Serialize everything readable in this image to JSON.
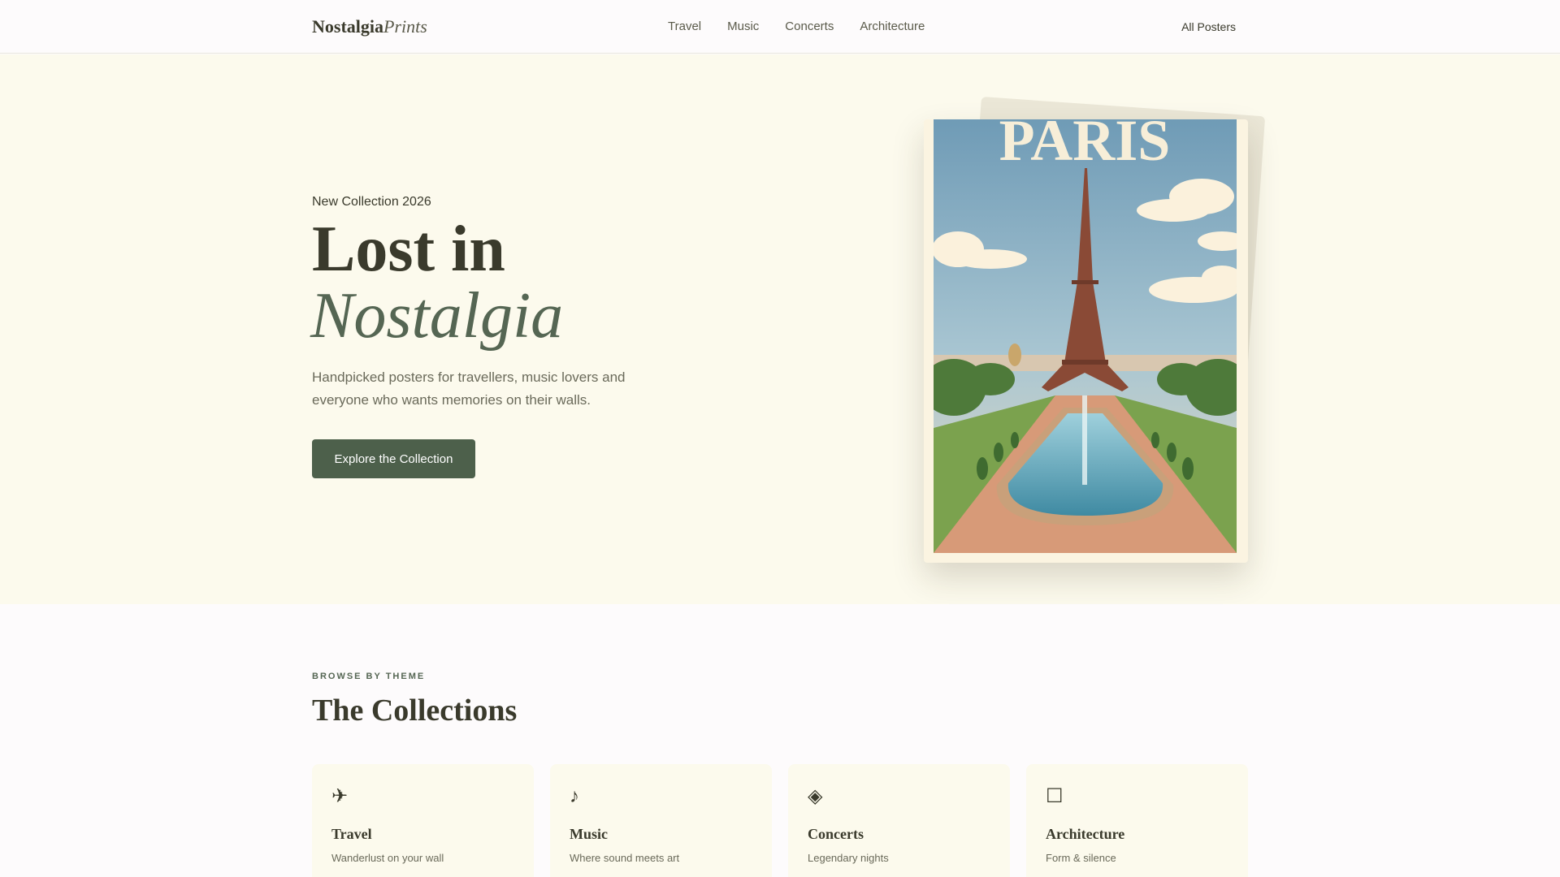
{
  "header": {
    "logo_bold": "Nostalgia",
    "logo_italic": "Prints",
    "nav": [
      "Travel",
      "Music",
      "Concerts",
      "Architecture"
    ],
    "all_posters": "All Posters"
  },
  "hero": {
    "eyebrow": "New Collection 2026",
    "title_line1": "Lost in",
    "title_line2": "Nostalgia",
    "lead": "Handpicked posters for travellers, music lovers and everyone who wants memories on their walls.",
    "cta": "Explore the Collection",
    "poster_text": "PARIS"
  },
  "collections": {
    "eyebrow": "BROWSE BY THEME",
    "title": "The Collections",
    "cards": [
      {
        "icon": "✈",
        "icon_name": "airplane-icon",
        "title": "Travel",
        "subtitle": "Wanderlust on your wall"
      },
      {
        "icon": "♪",
        "icon_name": "music-note-icon",
        "title": "Music",
        "subtitle": "Where sound meets art"
      },
      {
        "icon": "◈",
        "icon_name": "diamond-icon",
        "title": "Concerts",
        "subtitle": "Legendary nights"
      },
      {
        "icon": "☐",
        "icon_name": "square-icon",
        "title": "Architecture",
        "subtitle": "Form & silence"
      }
    ]
  },
  "colors": {
    "accent": "#4d604b",
    "hero_bg": "#fcfaed",
    "text_dark": "#3a3a2c",
    "italic_green": "#556653"
  }
}
